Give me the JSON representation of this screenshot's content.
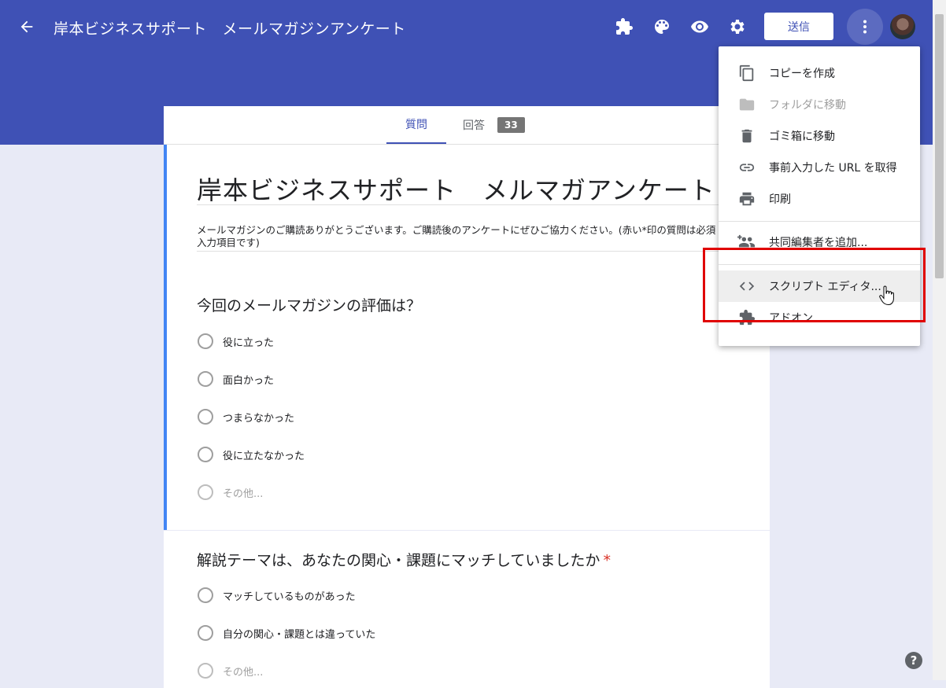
{
  "header": {
    "title": "岸本ビジネスサポート　メールマガジンアンケート",
    "send_label": "送信",
    "icons": [
      "back-arrow-icon",
      "addon-puzzle-icon",
      "palette-icon",
      "preview-eye-icon",
      "settings-gear-icon",
      "more-vert-icon"
    ],
    "accent": "#3f51b5"
  },
  "tabs": {
    "questions": "質問",
    "responses": "回答",
    "response_count": "33"
  },
  "form": {
    "title": "岸本ビジネスサポート　メルマガアンケート",
    "description": "メールマガジンのご購読ありがとうございます。ご購読後のアンケートにぜひご協力ください。(赤い*印の質問は必須入力項目です)",
    "q1": {
      "text": "今回のメールマガジンの評価は？",
      "options": [
        "役に立った",
        "面白かった",
        "つまらなかった",
        "役に立たなかった"
      ],
      "other": "その他..."
    },
    "q2": {
      "text": "解説テーマは、あなたの関心・課題にマッチしていましたか",
      "required_mark": "*",
      "options": [
        "マッチしているものがあった",
        "自分の関心・課題とは違っていた"
      ],
      "other": "その他..."
    }
  },
  "menu": {
    "items": [
      {
        "label": "コピーを作成",
        "icon": "copy-icon"
      },
      {
        "label": "フォルダに移動",
        "icon": "folder-icon",
        "disabled": true
      },
      {
        "label": "ゴミ箱に移動",
        "icon": "trash-icon"
      },
      {
        "label": "事前入力した URL を取得",
        "icon": "link-icon"
      },
      {
        "label": "印刷",
        "icon": "print-icon"
      },
      {
        "label": "共同編集者を追加...",
        "icon": "add-people-icon"
      },
      {
        "label": "スクリプト エディタ...",
        "icon": "code-icon",
        "hovered": true
      },
      {
        "label": "アドオン...",
        "icon": "puzzle-icon"
      }
    ]
  },
  "help": "?"
}
